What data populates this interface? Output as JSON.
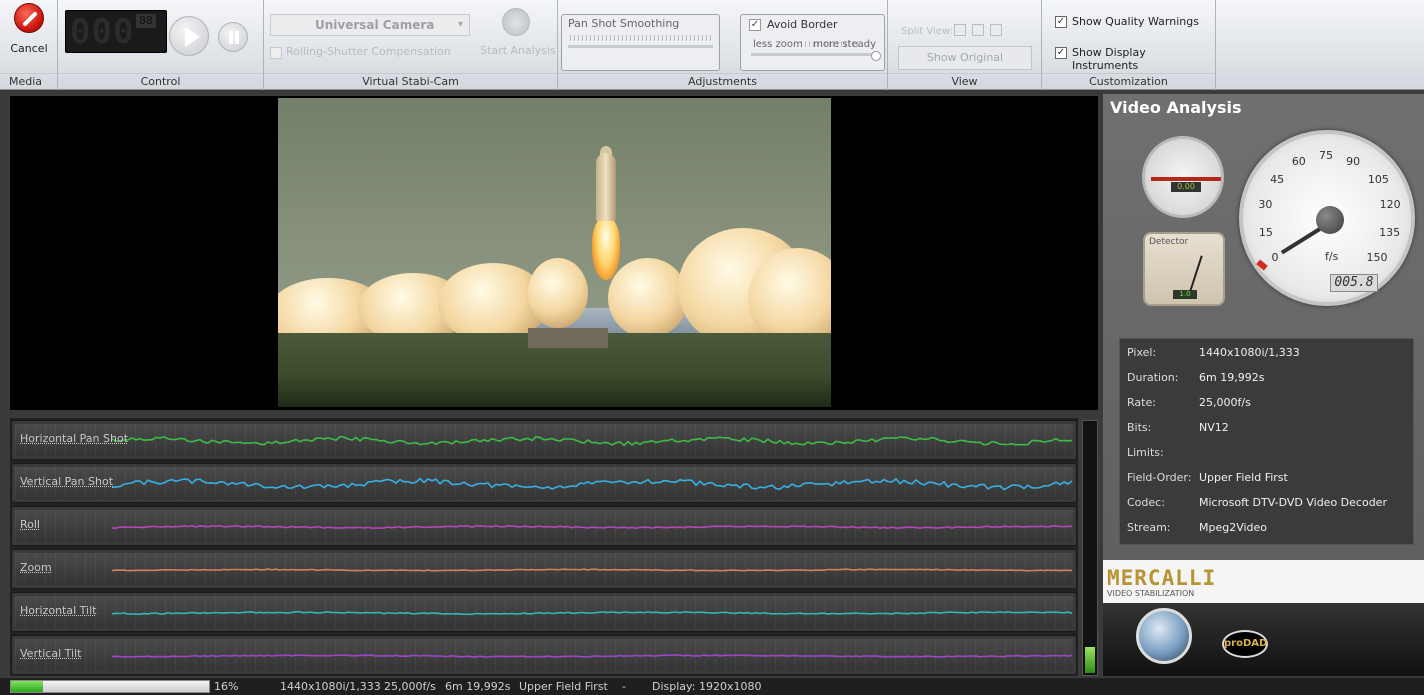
{
  "ribbon": {
    "media": {
      "cancel_label": "Cancel",
      "group_label": "Media"
    },
    "control": {
      "group_label": "Control",
      "lcd": "000",
      "lcd_small": "88"
    },
    "stabi": {
      "camera_value": "Universal Camera",
      "rolling_shutter_label": "Rolling-Shutter Compensation",
      "start_analysis_label": "Start Analysis",
      "group_label": "Virtual Stabi-Cam"
    },
    "adjustments": {
      "pan_title": "Pan Shot Smoothing",
      "avoid_border_label": "Avoid Border",
      "avoid_border_checked": "✓",
      "less_zoom": "less zoom",
      "more_steady": "more steady",
      "group_label": "Adjustments"
    },
    "view": {
      "split_label": "Split View:",
      "show_original": "Show Original",
      "group_label": "View"
    },
    "customization": {
      "quality_label": "Show Quality Warnings",
      "instruments_label": "Show Display Instruments",
      "check_mark": "✓",
      "group_label": "Customization"
    }
  },
  "graphs": [
    {
      "label": "Horizontal Pan Shot",
      "color": "#3dbb46"
    },
    {
      "label": "Vertical Pan Shot",
      "color": "#36b0e3"
    },
    {
      "label": "Roll",
      "color": "#b348b8"
    },
    {
      "label": "Zoom",
      "color": "#d08060"
    },
    {
      "label": "Horizontal Tilt",
      "color": "#32b7b0"
    },
    {
      "label": "Vertical Tilt",
      "color": "#9a48c8"
    }
  ],
  "analysis": {
    "title": "Video Analysis",
    "detector_label": "Detector",
    "small_gauge_digits": "0.00",
    "detector_digits": "1.0",
    "big_gauge_unit": "f/s",
    "big_gauge_digits": "005.8",
    "big_gauge_ticks": [
      "0",
      "15",
      "30",
      "45",
      "60",
      "75",
      "90",
      "105",
      "120",
      "135",
      "150"
    ],
    "info": [
      {
        "key": "Pixel:",
        "value": "1440x1080i/1,333"
      },
      {
        "key": "Duration:",
        "value": "6m 19,992s"
      },
      {
        "key": "Rate:",
        "value": "25,000f/s"
      },
      {
        "key": "Bits:",
        "value": "NV12"
      },
      {
        "key": "Limits:",
        "value": ""
      },
      {
        "key": "Field-Order:",
        "value": "Upper Field First"
      },
      {
        "key": "Codec:",
        "value": "Microsoft DTV-DVD Video Decoder"
      },
      {
        "key": "Stream:",
        "value": "Mpeg2Video"
      }
    ]
  },
  "brand": {
    "logo": "MERCALLI",
    "subtitle": "VIDEO STABILIZATION",
    "prodad": "proDAD"
  },
  "status": {
    "progress_percent": 16,
    "progress_label": "16%",
    "resolution": "1440x1080i/1,333",
    "rate": "25,000f/s",
    "duration": "6m 19,992s",
    "field_order": "Upper Field First",
    "dash": "-",
    "display": "Display:  1920x1080"
  }
}
